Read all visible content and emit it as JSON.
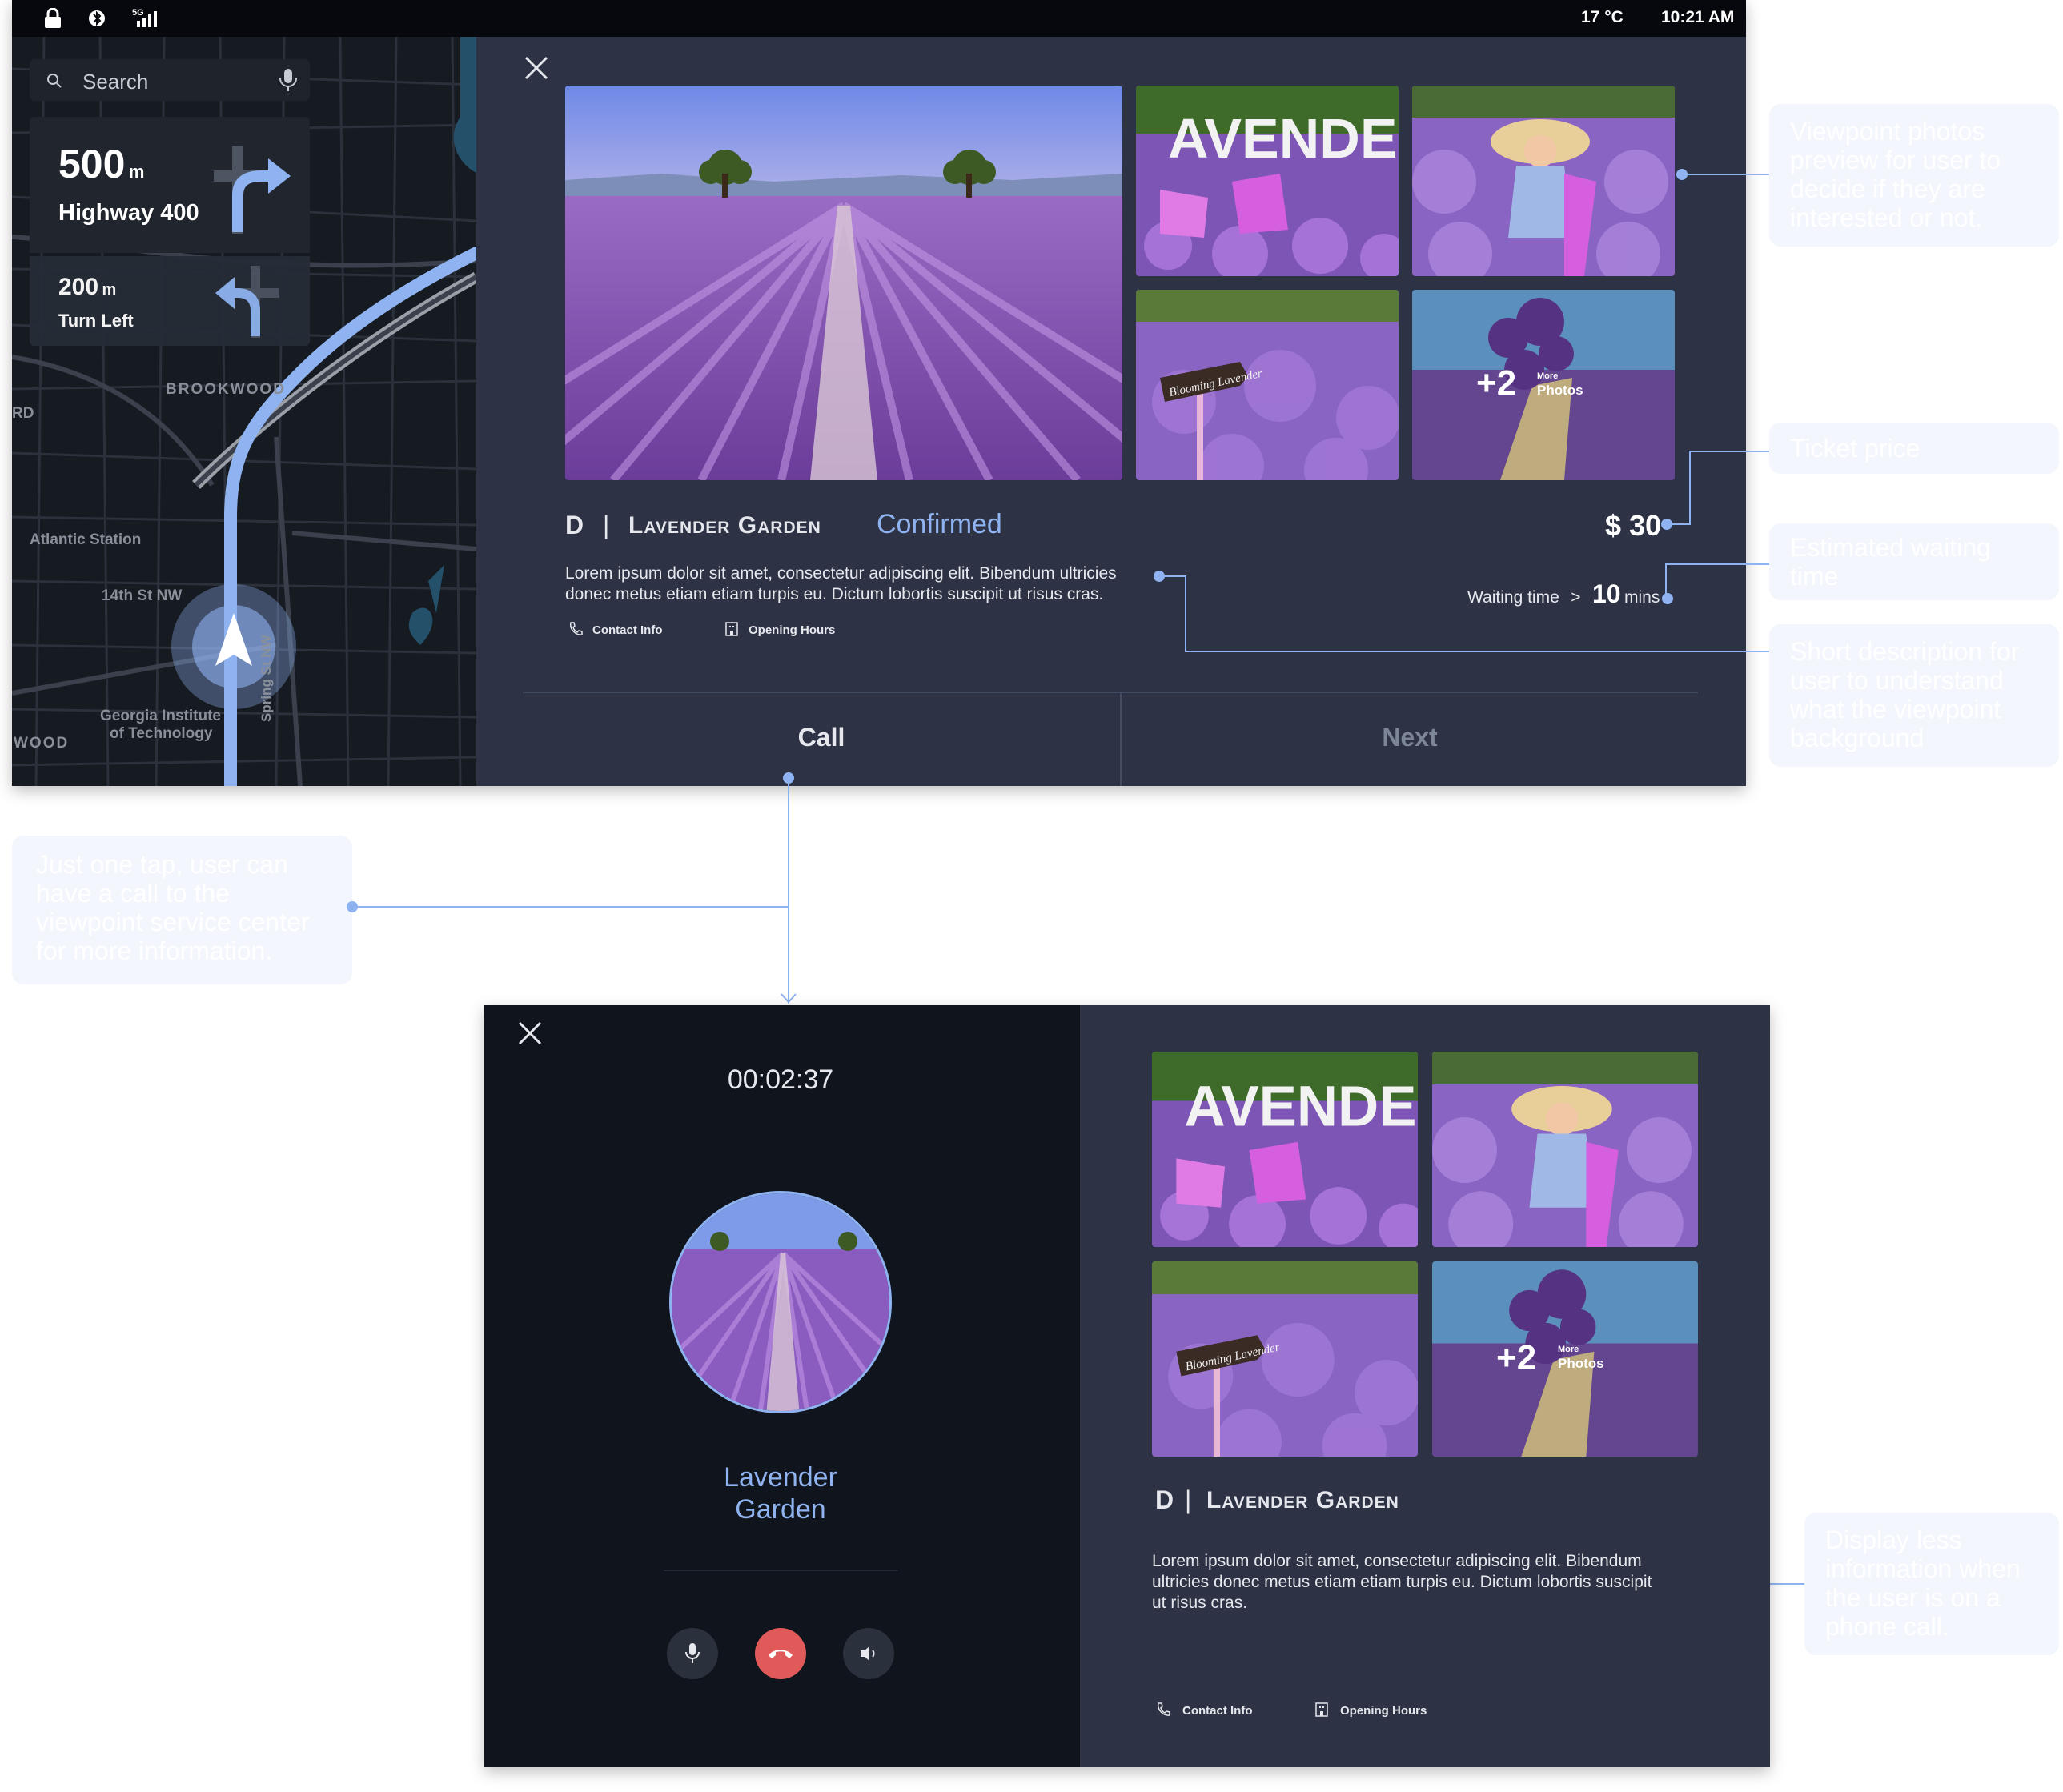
{
  "status_bar": {
    "temperature": "17 °C",
    "time": "10:21 AM"
  },
  "map": {
    "search_placeholder": "Search",
    "primary_instruction": {
      "distance": "500",
      "unit": "m",
      "road": "Highway 400"
    },
    "secondary_instruction": {
      "distance": "200",
      "unit": "m",
      "action": "Turn Left"
    },
    "labels": [
      "BROOKWOOD",
      "Atlantic Station",
      "14th St NW",
      "Georgia Institute",
      "of Technology",
      "Spring St NW",
      "WOOD",
      "RD"
    ]
  },
  "viewpoint": {
    "letter": "D",
    "separator": "|",
    "name": "Lavender Garden",
    "status": "Confirmed",
    "price": "$ 30",
    "description": "Lorem ipsum dolor sit amet, consectetur adipiscing elit. Bibendum ultricies donec metus etiam etiam turpis eu. Dictum lobortis suscipit ut risus cras.",
    "description_line1": "Lorem ipsum dolor sit amet, consectetur adipiscing elit. Bibendum ultricies",
    "description_line2": "donec metus etiam etiam turpis eu. Dictum lobortis suscipit ut risus cras.",
    "contact_label": "Contact Info",
    "hours_label": "Opening Hours",
    "waiting_label": "Waiting time",
    "waiting_arrow": ">",
    "waiting_value": "10",
    "waiting_unit": "mins",
    "more_photos_count": "+2",
    "more_photos_word1": "More",
    "more_photos_word2": "Photos",
    "sign_text": "Blooming Lavender"
  },
  "actions": {
    "call": "Call",
    "next": "Next"
  },
  "call_screen": {
    "timer": "00:02:37",
    "caller_line1": "Lavender",
    "caller_line2": "Garden",
    "description_line1": "Lorem ipsum dolor sit amet, consectetur adipiscing elit. Bibendum",
    "description_line2": "ultricies donec metus etiam etiam turpis eu. Dictum lobortis suscipit",
    "description_line3": "ut risus cras."
  },
  "annotations": {
    "photos": [
      "Viewpoint photos",
      "preview for user to",
      "decide if they are",
      "interested or not."
    ],
    "ticket": [
      "Ticket price"
    ],
    "waiting": [
      "Estimated waiting",
      "time"
    ],
    "description": [
      "Short description for",
      "user to understand",
      "what the viewpoint",
      "background"
    ],
    "call": [
      "Just one tap, user can",
      "have a call to the",
      "viewpoint service center",
      "for more information."
    ],
    "less_info": [
      "Display less",
      "information when",
      "the user is on a",
      "phone call."
    ]
  },
  "colors": {
    "accent": "#8fb3f0",
    "panel": "#2d3345",
    "dark": "#10141c",
    "hangup": "#e05a5a",
    "lavender": "#8b5fc4"
  }
}
